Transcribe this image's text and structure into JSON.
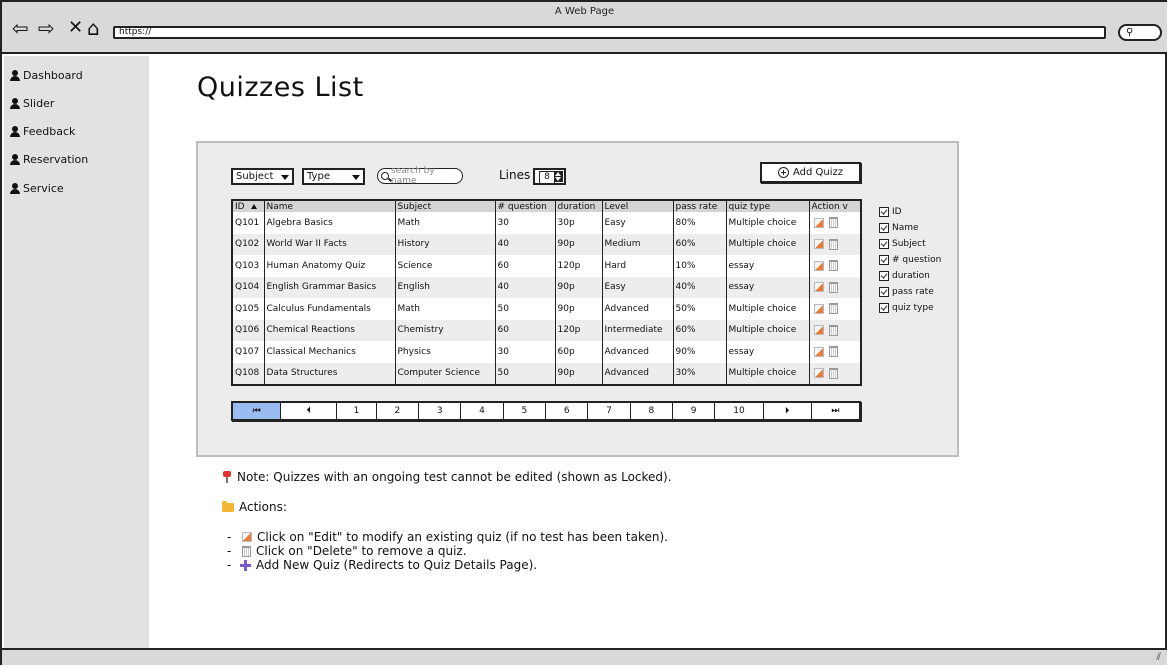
{
  "window": {
    "title": "A Web Page",
    "url": "https://",
    "search_value": ""
  },
  "nav_icons": [
    "back-arrow-icon",
    "forward-arrow-icon",
    "close-icon",
    "home-icon"
  ],
  "sidebar": {
    "items": [
      {
        "label": "Dashboard",
        "icon": "person-icon"
      },
      {
        "label": "Slider",
        "icon": "person-icon"
      },
      {
        "label": "Feedback",
        "icon": "person-icon"
      },
      {
        "label": "Reservation",
        "icon": "person-icon"
      },
      {
        "label": "Service",
        "icon": "person-icon"
      }
    ]
  },
  "page": {
    "title": "Quizzes List"
  },
  "filters": {
    "subject_label": "Subject",
    "type_label": "Type",
    "search_placeholder": "search by name",
    "lines_label": "Lines",
    "lines_value": "8",
    "add_button_label": "Add Quizz"
  },
  "table": {
    "headers": [
      "ID",
      "Name",
      "Subject",
      "# question",
      "duration",
      "Level",
      "pass rate",
      "quiz type",
      "Action v"
    ],
    "rows": [
      [
        "Q101",
        "Algebra Basics",
        "Math",
        "30",
        "30p",
        "Easy",
        "80%",
        "Multiple choice"
      ],
      [
        "Q102",
        "World War II Facts",
        "History",
        "40",
        "90p",
        "Medium",
        "60%",
        "Multiple choice"
      ],
      [
        "Q103",
        "Human Anatomy Quiz",
        "Science",
        "60",
        "120p",
        "Hard",
        "10%",
        "essay"
      ],
      [
        "Q104",
        "English Grammar Basics",
        "English",
        "40",
        "90p",
        "Easy",
        "40%",
        "essay"
      ],
      [
        "Q105",
        "Calculus Fundamentals",
        "Math",
        "50",
        "90p",
        "Advanced",
        "50%",
        "Multiple choice"
      ],
      [
        "Q106",
        "Chemical Reactions",
        "Chemistry",
        "60",
        "120p",
        "Intermediate",
        "60%",
        "Multiple choice"
      ],
      [
        "Q107",
        "Classical Mechanics",
        "Physics",
        "30",
        "60p",
        "Advanced",
        "90%",
        "essay"
      ],
      [
        "Q108",
        "Data Structures",
        "Computer Science",
        "50",
        "90p",
        "Advanced",
        "30%",
        "Multiple choice"
      ]
    ]
  },
  "pagination": {
    "items": [
      "⏮",
      "⏴",
      "1",
      "2",
      "3",
      "4",
      "5",
      "6",
      "7",
      "8",
      "9",
      "10",
      "⏵",
      "⏭"
    ],
    "active_index": 0
  },
  "column_toggles": [
    "ID",
    "Name",
    "Subject",
    "# question",
    "duration",
    "pass rate",
    "quiz type"
  ],
  "notes": {
    "note_text": "Note: Quizzes with an ongoing test cannot be edited (shown as Locked).",
    "actions_label": "Actions:",
    "edit_text": "Click on \"Edit\" to modify an existing quiz (if no test has been taken).",
    "delete_text": "Click on \"Delete\" to remove a quiz.",
    "add_text": "Add New Quiz (Redirects to Quiz Details Page).",
    "dash": "-"
  },
  "colors": {
    "titlebar": "#d9d9d9",
    "sidebar": "#e2e2e2",
    "panel": "#ececec",
    "active_page": "#9bbcf0"
  }
}
